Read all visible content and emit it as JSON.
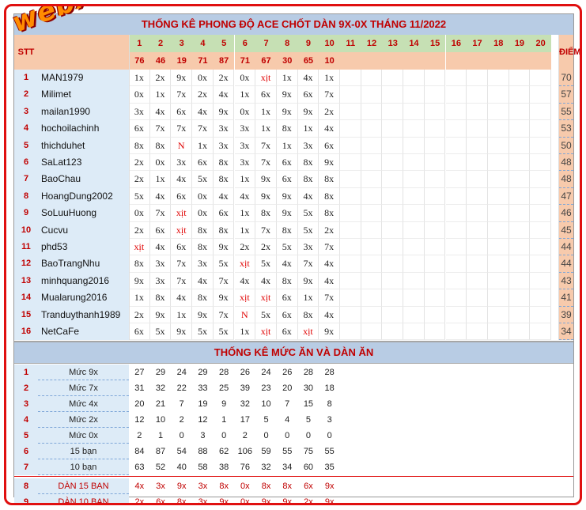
{
  "title": "THỐNG KÊ PHONG ĐỘ ACE CHỐT DÀN 9X-0X THÁNG 11/2022",
  "logo_text": "webxoso.net",
  "stt_header": "STT",
  "diem_header": "ĐIỂM",
  "day_numbers": [
    "1",
    "2",
    "3",
    "4",
    "5",
    "6",
    "7",
    "8",
    "9",
    "10",
    "11",
    "12",
    "13",
    "14",
    "15",
    "16",
    "17",
    "18",
    "19",
    "20"
  ],
  "results": [
    "76",
    "46",
    "19",
    "71",
    "87",
    "71",
    "67",
    "30",
    "65",
    "10"
  ],
  "players": [
    {
      "stt": "1",
      "name": "MAN1979",
      "picks": [
        "1x",
        "2x",
        "9x",
        "0x",
        "2x",
        "0x",
        "xịt",
        "1x",
        "4x",
        "1x"
      ],
      "score": "70"
    },
    {
      "stt": "2",
      "name": "Milimet",
      "picks": [
        "0x",
        "1x",
        "7x",
        "2x",
        "4x",
        "1x",
        "6x",
        "9x",
        "6x",
        "7x"
      ],
      "score": "57"
    },
    {
      "stt": "3",
      "name": "mailan1990",
      "picks": [
        "3x",
        "4x",
        "6x",
        "4x",
        "9x",
        "0x",
        "1x",
        "9x",
        "9x",
        "2x"
      ],
      "score": "55"
    },
    {
      "stt": "4",
      "name": "hochoilachinh",
      "picks": [
        "6x",
        "7x",
        "7x",
        "7x",
        "3x",
        "3x",
        "1x",
        "8x",
        "1x",
        "4x"
      ],
      "score": "53"
    },
    {
      "stt": "5",
      "name": "thichduhet",
      "picks": [
        "8x",
        "8x",
        "N",
        "1x",
        "3x",
        "3x",
        "7x",
        "1x",
        "3x",
        "6x"
      ],
      "score": "50"
    },
    {
      "stt": "6",
      "name": "SaLat123",
      "picks": [
        "2x",
        "0x",
        "3x",
        "6x",
        "8x",
        "3x",
        "7x",
        "6x",
        "8x",
        "9x"
      ],
      "score": "48"
    },
    {
      "stt": "7",
      "name": "BaoChau",
      "picks": [
        "2x",
        "1x",
        "4x",
        "5x",
        "8x",
        "1x",
        "9x",
        "6x",
        "8x",
        "8x"
      ],
      "score": "48"
    },
    {
      "stt": "8",
      "name": "HoangDung2002",
      "picks": [
        "5x",
        "4x",
        "6x",
        "0x",
        "4x",
        "4x",
        "9x",
        "9x",
        "4x",
        "8x"
      ],
      "score": "47"
    },
    {
      "stt": "9",
      "name": "SoLuuHuong",
      "picks": [
        "0x",
        "7x",
        "xịt",
        "0x",
        "6x",
        "1x",
        "8x",
        "9x",
        "5x",
        "8x"
      ],
      "score": "46"
    },
    {
      "stt": "10",
      "name": "Cucvu",
      "picks": [
        "2x",
        "6x",
        "xịt",
        "8x",
        "8x",
        "1x",
        "7x",
        "8x",
        "5x",
        "2x"
      ],
      "score": "45"
    },
    {
      "stt": "11",
      "name": "phd53",
      "picks": [
        "xịt",
        "4x",
        "6x",
        "8x",
        "9x",
        "2x",
        "2x",
        "5x",
        "3x",
        "7x"
      ],
      "score": "44"
    },
    {
      "stt": "12",
      "name": "BaoTrangNhu",
      "picks": [
        "8x",
        "3x",
        "7x",
        "3x",
        "5x",
        "xịt",
        "5x",
        "4x",
        "7x",
        "4x"
      ],
      "score": "44"
    },
    {
      "stt": "13",
      "name": "minhquang2016",
      "picks": [
        "9x",
        "3x",
        "7x",
        "4x",
        "7x",
        "4x",
        "4x",
        "8x",
        "9x",
        "4x"
      ],
      "score": "43"
    },
    {
      "stt": "14",
      "name": "Mualarung2016",
      "picks": [
        "1x",
        "8x",
        "4x",
        "8x",
        "9x",
        "xịt",
        "xịt",
        "6x",
        "1x",
        "7x"
      ],
      "score": "41"
    },
    {
      "stt": "15",
      "name": "Tranduythanh1989",
      "picks": [
        "2x",
        "9x",
        "1x",
        "9x",
        "7x",
        "N",
        "5x",
        "6x",
        "8x",
        "4x"
      ],
      "score": "39"
    },
    {
      "stt": "16",
      "name": "NetCaFe",
      "picks": [
        "6x",
        "5x",
        "9x",
        "5x",
        "5x",
        "1x",
        "xịt",
        "6x",
        "xịt",
        "9x"
      ],
      "score": "34"
    }
  ],
  "section2_title": "THỐNG KÊ MỨC ĂN VÀ DÀN ĂN",
  "stats": [
    {
      "stt": "1",
      "label": "Mức 9x",
      "values": [
        "27",
        "29",
        "24",
        "29",
        "28",
        "26",
        "24",
        "26",
        "28",
        "28"
      ],
      "red": false
    },
    {
      "stt": "2",
      "label": "Mức 7x",
      "values": [
        "31",
        "32",
        "22",
        "33",
        "25",
        "39",
        "23",
        "20",
        "30",
        "18"
      ],
      "red": false
    },
    {
      "stt": "3",
      "label": "Mức 4x",
      "values": [
        "20",
        "21",
        "7",
        "19",
        "9",
        "32",
        "10",
        "7",
        "15",
        "8"
      ],
      "red": false
    },
    {
      "stt": "4",
      "label": "Mức 2x",
      "values": [
        "12",
        "10",
        "2",
        "12",
        "1",
        "17",
        "5",
        "4",
        "5",
        "3"
      ],
      "red": false
    },
    {
      "stt": "5",
      "label": "Mức 0x",
      "values": [
        "2",
        "1",
        "0",
        "3",
        "0",
        "2",
        "0",
        "0",
        "0",
        "0"
      ],
      "red": false
    },
    {
      "stt": "6",
      "label": "15 bạn",
      "values": [
        "84",
        "87",
        "54",
        "88",
        "62",
        "106",
        "59",
        "55",
        "75",
        "55"
      ],
      "red": false
    },
    {
      "stt": "7",
      "label": "10 bạn",
      "values": [
        "63",
        "52",
        "40",
        "58",
        "38",
        "76",
        "32",
        "34",
        "60",
        "35"
      ],
      "red": false
    },
    {
      "stt": "8",
      "label": "DÀN 15 BẠN",
      "values": [
        "4x",
        "3x",
        "9x",
        "3x",
        "8x",
        "0x",
        "8x",
        "8x",
        "6x",
        "9x"
      ],
      "red": true
    },
    {
      "stt": "9",
      "label": "DÀN 10 BẠN",
      "values": [
        "2x",
        "6x",
        "8x",
        "3x",
        "9x",
        "0x",
        "9x",
        "9x",
        "2x",
        "9x"
      ],
      "red": true
    }
  ],
  "colors": {
    "frame": "#e01010",
    "title_bg": "#b8cce4",
    "title_text": "#c00000",
    "header_green": "#c6e0b4",
    "header_salmon": "#f7caac",
    "name_bg": "#ddebf7",
    "miss_text": "#e00000",
    "logo": "#ff8c00"
  }
}
